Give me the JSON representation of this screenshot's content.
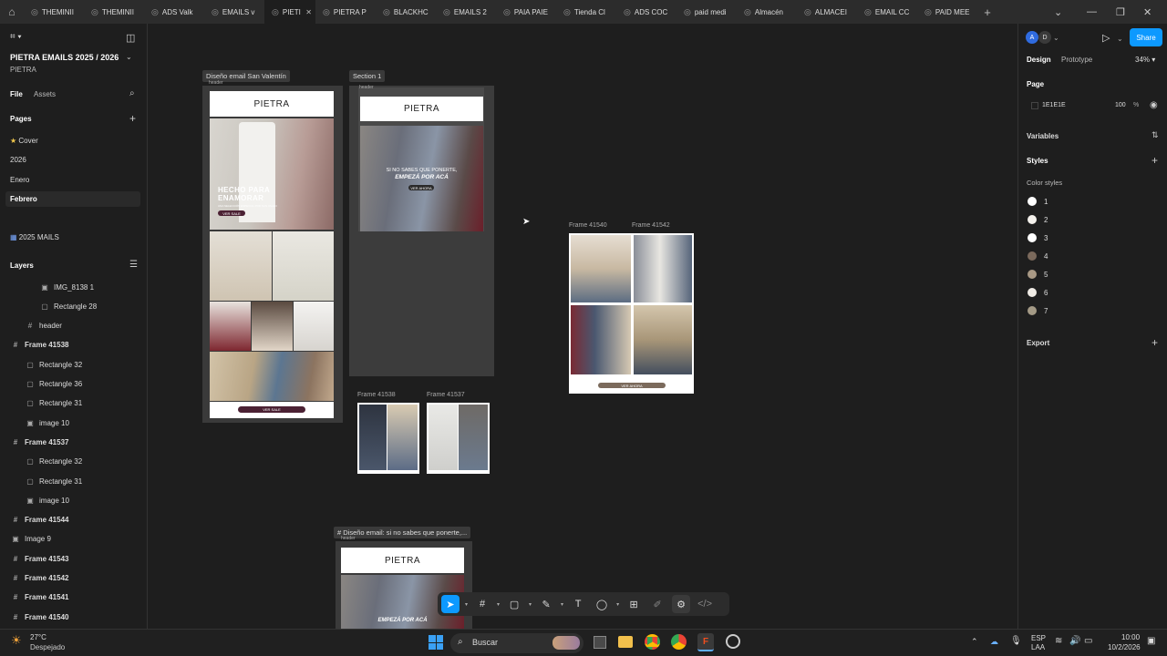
{
  "tabs": [
    {
      "label": "THEMINII"
    },
    {
      "label": "THEMINII"
    },
    {
      "label": "ADS Valk"
    },
    {
      "label": "EMAILS v"
    },
    {
      "label": "PIETI",
      "active": true
    },
    {
      "label": "PIETRA P"
    },
    {
      "label": "BLACKHC"
    },
    {
      "label": "EMAILS 2"
    },
    {
      "label": "PAIA PAIE"
    },
    {
      "label": "Tienda Cl"
    },
    {
      "label": "ADS COC"
    },
    {
      "label": "paid medi"
    },
    {
      "label": "Almacén"
    },
    {
      "label": "ALMACEI"
    },
    {
      "label": "EMAIL CC"
    },
    {
      "label": "PAID MEE"
    }
  ],
  "left": {
    "project_title": "PIETRA EMAILS 2025 / 2026",
    "project_subtitle": "PIETRA",
    "file_tab": "File",
    "assets_tab": "Assets",
    "pages_heading": "Pages",
    "pages": [
      "Cover",
      "2026",
      "Enero",
      "Febrero",
      "2025 MAILS"
    ],
    "layers_heading": "Layers",
    "layers": [
      {
        "name": "IMG_8138 1",
        "icon": "image-icon",
        "indent": 2,
        "bold": false
      },
      {
        "name": "Rectangle 28",
        "icon": "rectangle-icon",
        "indent": 2,
        "bold": false
      },
      {
        "name": "header",
        "icon": "frame-icon",
        "indent": 1,
        "bold": false
      },
      {
        "name": "Frame 41538",
        "icon": "frame-icon",
        "indent": 0,
        "bold": true
      },
      {
        "name": "Rectangle 32",
        "icon": "rectangle-icon",
        "indent": 1,
        "bold": false
      },
      {
        "name": "Rectangle 36",
        "icon": "rectangle-icon",
        "indent": 1,
        "bold": false
      },
      {
        "name": "Rectangle 31",
        "icon": "rectangle-icon",
        "indent": 1,
        "bold": false
      },
      {
        "name": "image 10",
        "icon": "image-icon",
        "indent": 1,
        "bold": false
      },
      {
        "name": "Frame 41537",
        "icon": "frame-icon",
        "indent": 0,
        "bold": true
      },
      {
        "name": "Rectangle 32",
        "icon": "rectangle-icon",
        "indent": 1,
        "bold": false
      },
      {
        "name": "Rectangle 31",
        "icon": "rectangle-icon",
        "indent": 1,
        "bold": false
      },
      {
        "name": "image 10",
        "icon": "image-icon",
        "indent": 1,
        "bold": false
      },
      {
        "name": "Frame 41544",
        "icon": "frame-icon",
        "indent": 0,
        "bold": true
      },
      {
        "name": "Image 9",
        "icon": "image-icon",
        "indent": 0,
        "bold": false
      },
      {
        "name": "Frame 41543",
        "icon": "frame-icon",
        "indent": 0,
        "bold": true
      },
      {
        "name": "Frame 41542",
        "icon": "frame-icon",
        "indent": 0,
        "bold": true
      },
      {
        "name": "Frame 41541",
        "icon": "frame-icon",
        "indent": 0,
        "bold": true
      },
      {
        "name": "Frame 41540",
        "icon": "frame-icon",
        "indent": 0,
        "bold": true
      }
    ]
  },
  "right": {
    "avatars": [
      "A",
      "D"
    ],
    "share_label": "Share",
    "design_tab": "Design",
    "prototype_tab": "Prototype",
    "zoom": "34%",
    "page_heading": "Page",
    "page_color": "1E1E1E",
    "page_opacity": "100",
    "page_opacity_unit": "%",
    "variables_heading": "Variables",
    "styles_heading": "Styles",
    "color_styles_heading": "Color styles",
    "color_styles": [
      {
        "name": "1",
        "color": "#ffffff"
      },
      {
        "name": "2",
        "color": "#f4f1ec"
      },
      {
        "name": "3",
        "color": "#ffffff"
      },
      {
        "name": "4",
        "color": "#7b6a5c"
      },
      {
        "name": "5",
        "color": "#a99985"
      },
      {
        "name": "6",
        "color": "#efebe5"
      },
      {
        "name": "7",
        "color": "#a49a86"
      }
    ],
    "export_heading": "Export"
  },
  "canvas": {
    "frame_valentin_label": "Diseño email San Valentín",
    "section1_label": "Section 1",
    "header_label_1": "header",
    "header_label_2": "header",
    "brand": "PIETRA",
    "hero_headline_1": "HECHO PARA",
    "hero_headline_2": "ENAMORAR",
    "hero_sub": "UNA SELECCIÓN ESPECIAL POR SAN VALEN",
    "hero_btn": "VER SALE",
    "footer_btn": "VER SALE",
    "section_hero_text_1": "SI NO SABES QUE PONERTE,",
    "section_hero_text_2": "EMPEZÁ POR ACÁ",
    "section_hero_btn": "VER AHORA",
    "frame_41540": "Frame 41540",
    "frame_41542": "Frame 41542",
    "frame_41538": "Frame 41538",
    "frame_41537": "Frame 41537",
    "grid_btn": "VER AHORA",
    "bottom_frame_label": "# Diseño email: si no sabes que ponerte,...",
    "bottom_header_label": "header",
    "bottom_hero_text": "EMPEZÁ POR ACÁ"
  },
  "taskbar": {
    "weather_temp": "27°C",
    "weather_desc": "Despejado",
    "search_label": "Buscar",
    "lang_1": "ESP",
    "lang_2": "LAA",
    "time": "10:00",
    "date": "10/2/2026"
  }
}
